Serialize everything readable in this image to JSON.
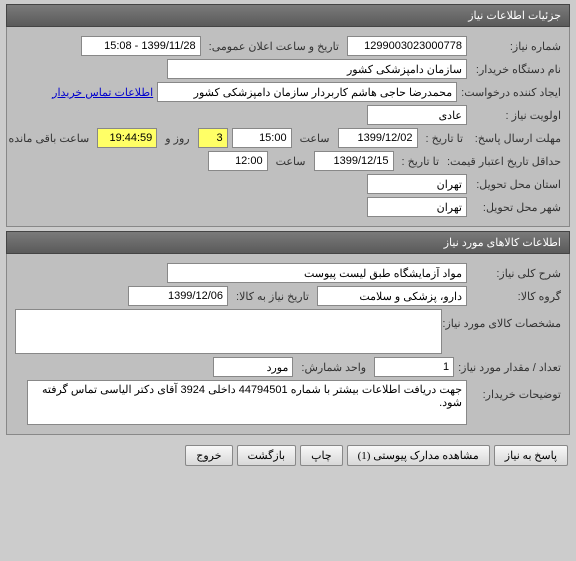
{
  "panel1": {
    "title": "جزئیات اطلاعات نیاز",
    "niaz_no_label": "شماره نیاز:",
    "niaz_no": "1299003023000778",
    "announce_label": "تاریخ و ساعت اعلان عمومی:",
    "announce_date": "1399/11/28 - 15:08",
    "buyer_label": "نام دستگاه خریدار:",
    "buyer": "سازمان دامپزشکی کشور",
    "creator_label": "ایجاد کننده درخواست:",
    "creator": "محمدرضا حاجی هاشم کاربردار سازمان دامپزشکی کشور",
    "contact_link": "اطلاعات تماس خریدار",
    "priority_label": "اولویت نیاز :",
    "priority": "عادی",
    "deadline_label": "مهلت ارسال پاسخ:",
    "until_label": "تا تاریخ :",
    "deadline_date": "1399/12/02",
    "time_label": "ساعت",
    "deadline_time": "15:00",
    "days": "3",
    "days_label": "روز و",
    "countdown": "19:44:59",
    "remain_label": "ساعت باقی مانده",
    "min_validity_label": "حداقل تاریخ اعتبار قیمت:",
    "validity_date": "1399/12/15",
    "validity_time": "12:00",
    "province_label": "استان محل تحویل:",
    "province": "تهران",
    "city_label": "شهر محل تحویل:",
    "city": "تهران"
  },
  "panel2": {
    "title": "اطلاعات کالاهای مورد نیاز",
    "desc_label": "شرح کلی نیاز:",
    "desc": "مواد آزمایشگاه طبق لیست پیوست",
    "group_label": "گروه کالا:",
    "group": "دارو، پزشکی و سلامت",
    "need_date_label": "تاریخ نیاز به کالا:",
    "need_date": "1399/12/06",
    "spec_label": "مشخصات کالای مورد نیاز:",
    "spec": "",
    "qty_label": "تعداد / مقدار مورد نیاز:",
    "qty": "1",
    "unit_label": "واحد شمارش:",
    "unit": "مورد",
    "notes_label": "توضیحات خریدار:",
    "notes": "جهت دریافت اطلاعات بیشتر با شماره 44794501 داخلی 3924 آقای دکتر الیاسی تماس گرفته شود."
  },
  "buttons": {
    "reply": "پاسخ به نیاز",
    "attachments": "مشاهده مدارک پیوستی (1)",
    "print": "چاپ",
    "back": "بازگشت",
    "exit": "خروج"
  }
}
